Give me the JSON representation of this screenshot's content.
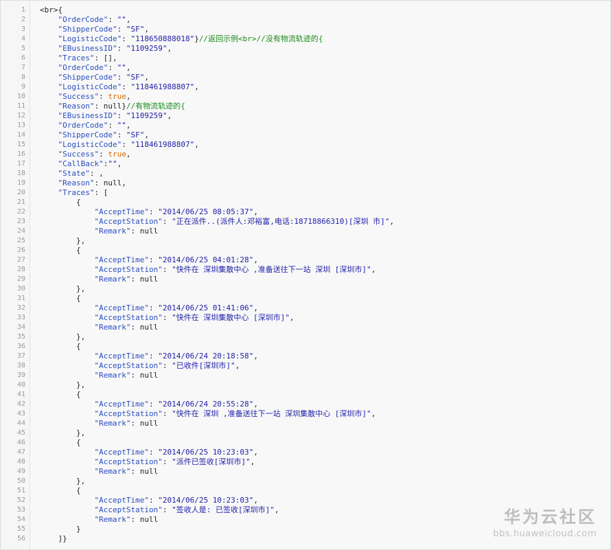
{
  "code_lines": [
    {
      "n": "1",
      "tokens": [
        [
          "punc",
          "<br>{"
        ]
      ]
    },
    {
      "n": "2",
      "tokens": [
        [
          "punc",
          "    "
        ],
        [
          "key",
          "\"OrderCode\""
        ],
        [
          "punc",
          ": "
        ],
        [
          "str",
          "\"\""
        ],
        [
          "punc",
          ","
        ]
      ]
    },
    {
      "n": "3",
      "tokens": [
        [
          "punc",
          "    "
        ],
        [
          "key",
          "\"ShipperCode\""
        ],
        [
          "punc",
          ": "
        ],
        [
          "str",
          "\"SF\""
        ],
        [
          "punc",
          ","
        ]
      ]
    },
    {
      "n": "4",
      "tokens": [
        [
          "punc",
          "    "
        ],
        [
          "key",
          "\"LogisticCode\""
        ],
        [
          "punc",
          ": "
        ],
        [
          "str",
          "\"118650888018\""
        ],
        [
          "punc",
          "}"
        ],
        [
          "comment",
          "//返回示例<br>//没有物流轨迹的{"
        ]
      ]
    },
    {
      "n": "5",
      "tokens": [
        [
          "punc",
          "    "
        ],
        [
          "key",
          "\"EBusinessID\""
        ],
        [
          "punc",
          ": "
        ],
        [
          "str",
          "\"1109259\""
        ],
        [
          "punc",
          ","
        ]
      ]
    },
    {
      "n": "6",
      "tokens": [
        [
          "punc",
          "    "
        ],
        [
          "key",
          "\"Traces\""
        ],
        [
          "punc",
          ": [],"
        ]
      ]
    },
    {
      "n": "7",
      "tokens": [
        [
          "punc",
          "    "
        ],
        [
          "key",
          "\"OrderCode\""
        ],
        [
          "punc",
          ": "
        ],
        [
          "str",
          "\"\""
        ],
        [
          "punc",
          ","
        ]
      ]
    },
    {
      "n": "8",
      "tokens": [
        [
          "punc",
          "    "
        ],
        [
          "key",
          "\"ShipperCode\""
        ],
        [
          "punc",
          ": "
        ],
        [
          "str",
          "\"SF\""
        ],
        [
          "punc",
          ","
        ]
      ]
    },
    {
      "n": "9",
      "tokens": [
        [
          "punc",
          "    "
        ],
        [
          "key",
          "\"LogisticCode\""
        ],
        [
          "punc",
          ": "
        ],
        [
          "str",
          "\"118461988807\""
        ],
        [
          "punc",
          ","
        ]
      ]
    },
    {
      "n": "10",
      "tokens": [
        [
          "punc",
          "    "
        ],
        [
          "key",
          "\"Success\""
        ],
        [
          "punc",
          ": "
        ],
        [
          "bool",
          "true"
        ],
        [
          "punc",
          ","
        ]
      ]
    },
    {
      "n": "11",
      "tokens": [
        [
          "punc",
          "    "
        ],
        [
          "key",
          "\"Reason\""
        ],
        [
          "punc",
          ": null}"
        ],
        [
          "comment",
          "//有物流轨迹的{"
        ]
      ]
    },
    {
      "n": "12",
      "tokens": [
        [
          "punc",
          "    "
        ],
        [
          "key",
          "\"EBusinessID\""
        ],
        [
          "punc",
          ": "
        ],
        [
          "str",
          "\"1109259\""
        ],
        [
          "punc",
          ","
        ]
      ]
    },
    {
      "n": "13",
      "tokens": [
        [
          "punc",
          "    "
        ],
        [
          "key",
          "\"OrderCode\""
        ],
        [
          "punc",
          ": "
        ],
        [
          "str",
          "\"\""
        ],
        [
          "punc",
          ","
        ]
      ]
    },
    {
      "n": "14",
      "tokens": [
        [
          "punc",
          "    "
        ],
        [
          "key",
          "\"ShipperCode\""
        ],
        [
          "punc",
          ": "
        ],
        [
          "str",
          "\"SF\""
        ],
        [
          "punc",
          ","
        ]
      ]
    },
    {
      "n": "15",
      "tokens": [
        [
          "punc",
          "    "
        ],
        [
          "key",
          "\"LogisticCode\""
        ],
        [
          "punc",
          ": "
        ],
        [
          "str",
          "\"118461988807\""
        ],
        [
          "punc",
          ","
        ]
      ]
    },
    {
      "n": "16",
      "tokens": [
        [
          "punc",
          "    "
        ],
        [
          "key",
          "\"Success\""
        ],
        [
          "punc",
          ": "
        ],
        [
          "bool",
          "true"
        ],
        [
          "punc",
          ","
        ]
      ]
    },
    {
      "n": "17",
      "tokens": [
        [
          "punc",
          "    "
        ],
        [
          "key",
          "\"CallBack\""
        ],
        [
          "punc",
          ":"
        ],
        [
          "str",
          "\"\""
        ],
        [
          "punc",
          ","
        ]
      ]
    },
    {
      "n": "18",
      "tokens": [
        [
          "punc",
          "    "
        ],
        [
          "key",
          "\"State\""
        ],
        [
          "punc",
          ": ,"
        ]
      ]
    },
    {
      "n": "19",
      "tokens": [
        [
          "punc",
          "    "
        ],
        [
          "key",
          "\"Reason\""
        ],
        [
          "punc",
          ": null,"
        ]
      ]
    },
    {
      "n": "20",
      "tokens": [
        [
          "punc",
          "    "
        ],
        [
          "key",
          "\"Traces\""
        ],
        [
          "punc",
          ": ["
        ]
      ]
    },
    {
      "n": "21",
      "tokens": [
        [
          "punc",
          "        {"
        ]
      ]
    },
    {
      "n": "22",
      "tokens": [
        [
          "punc",
          "            "
        ],
        [
          "key",
          "\"AcceptTime\""
        ],
        [
          "punc",
          ": "
        ],
        [
          "str",
          "\"2014/06/25 08:05:37\""
        ],
        [
          "punc",
          ","
        ]
      ]
    },
    {
      "n": "23",
      "tokens": [
        [
          "punc",
          "            "
        ],
        [
          "key",
          "\"AcceptStation\""
        ],
        [
          "punc",
          ": "
        ],
        [
          "str",
          "\"正在派件..(派件人:邓裕富,电话:18718866310)[深圳 市]\""
        ],
        [
          "punc",
          ","
        ]
      ]
    },
    {
      "n": "24",
      "tokens": [
        [
          "punc",
          "            "
        ],
        [
          "key",
          "\"Remark\""
        ],
        [
          "punc",
          ": null"
        ]
      ]
    },
    {
      "n": "25",
      "tokens": [
        [
          "punc",
          "        },"
        ]
      ]
    },
    {
      "n": "26",
      "tokens": [
        [
          "punc",
          "        {"
        ]
      ]
    },
    {
      "n": "27",
      "tokens": [
        [
          "punc",
          "            "
        ],
        [
          "key",
          "\"AcceptTime\""
        ],
        [
          "punc",
          ": "
        ],
        [
          "str",
          "\"2014/06/25 04:01:28\""
        ],
        [
          "punc",
          ","
        ]
      ]
    },
    {
      "n": "28",
      "tokens": [
        [
          "punc",
          "            "
        ],
        [
          "key",
          "\"AcceptStation\""
        ],
        [
          "punc",
          ": "
        ],
        [
          "str",
          "\"快件在 深圳集散中心 ,准备送往下一站 深圳 [深圳市]\""
        ],
        [
          "punc",
          ","
        ]
      ]
    },
    {
      "n": "29",
      "tokens": [
        [
          "punc",
          "            "
        ],
        [
          "key",
          "\"Remark\""
        ],
        [
          "punc",
          ": null"
        ]
      ]
    },
    {
      "n": "30",
      "tokens": [
        [
          "punc",
          "        },"
        ]
      ]
    },
    {
      "n": "31",
      "tokens": [
        [
          "punc",
          "        {"
        ]
      ]
    },
    {
      "n": "32",
      "tokens": [
        [
          "punc",
          "            "
        ],
        [
          "key",
          "\"AcceptTime\""
        ],
        [
          "punc",
          ": "
        ],
        [
          "str",
          "\"2014/06/25 01:41:06\""
        ],
        [
          "punc",
          ","
        ]
      ]
    },
    {
      "n": "33",
      "tokens": [
        [
          "punc",
          "            "
        ],
        [
          "key",
          "\"AcceptStation\""
        ],
        [
          "punc",
          ": "
        ],
        [
          "str",
          "\"快件在 深圳集散中心 [深圳市]\""
        ],
        [
          "punc",
          ","
        ]
      ]
    },
    {
      "n": "34",
      "tokens": [
        [
          "punc",
          "            "
        ],
        [
          "key",
          "\"Remark\""
        ],
        [
          "punc",
          ": null"
        ]
      ]
    },
    {
      "n": "35",
      "tokens": [
        [
          "punc",
          "        },"
        ]
      ]
    },
    {
      "n": "36",
      "tokens": [
        [
          "punc",
          "        {"
        ]
      ]
    },
    {
      "n": "37",
      "tokens": [
        [
          "punc",
          "            "
        ],
        [
          "key",
          "\"AcceptTime\""
        ],
        [
          "punc",
          ": "
        ],
        [
          "str",
          "\"2014/06/24 20:18:58\""
        ],
        [
          "punc",
          ","
        ]
      ]
    },
    {
      "n": "38",
      "tokens": [
        [
          "punc",
          "            "
        ],
        [
          "key",
          "\"AcceptStation\""
        ],
        [
          "punc",
          ": "
        ],
        [
          "str",
          "\"已收件[深圳市]\""
        ],
        [
          "punc",
          ","
        ]
      ]
    },
    {
      "n": "39",
      "tokens": [
        [
          "punc",
          "            "
        ],
        [
          "key",
          "\"Remark\""
        ],
        [
          "punc",
          ": null"
        ]
      ]
    },
    {
      "n": "40",
      "tokens": [
        [
          "punc",
          "        },"
        ]
      ]
    },
    {
      "n": "41",
      "tokens": [
        [
          "punc",
          "        {"
        ]
      ]
    },
    {
      "n": "42",
      "tokens": [
        [
          "punc",
          "            "
        ],
        [
          "key",
          "\"AcceptTime\""
        ],
        [
          "punc",
          ": "
        ],
        [
          "str",
          "\"2014/06/24 20:55:28\""
        ],
        [
          "punc",
          ","
        ]
      ]
    },
    {
      "n": "43",
      "tokens": [
        [
          "punc",
          "            "
        ],
        [
          "key",
          "\"AcceptStation\""
        ],
        [
          "punc",
          ": "
        ],
        [
          "str",
          "\"快件在 深圳 ,准备送往下一站 深圳集散中心 [深圳市]\""
        ],
        [
          "punc",
          ","
        ]
      ]
    },
    {
      "n": "44",
      "tokens": [
        [
          "punc",
          "            "
        ],
        [
          "key",
          "\"Remark\""
        ],
        [
          "punc",
          ": null"
        ]
      ]
    },
    {
      "n": "45",
      "tokens": [
        [
          "punc",
          "        },"
        ]
      ]
    },
    {
      "n": "46",
      "tokens": [
        [
          "punc",
          "        {"
        ]
      ]
    },
    {
      "n": "47",
      "tokens": [
        [
          "punc",
          "            "
        ],
        [
          "key",
          "\"AcceptTime\""
        ],
        [
          "punc",
          ": "
        ],
        [
          "str",
          "\"2014/06/25 10:23:03\""
        ],
        [
          "punc",
          ","
        ]
      ]
    },
    {
      "n": "48",
      "tokens": [
        [
          "punc",
          "            "
        ],
        [
          "key",
          "\"AcceptStation\""
        ],
        [
          "punc",
          ": "
        ],
        [
          "str",
          "\"派件已签收[深圳市]\""
        ],
        [
          "punc",
          ","
        ]
      ]
    },
    {
      "n": "49",
      "tokens": [
        [
          "punc",
          "            "
        ],
        [
          "key",
          "\"Remark\""
        ],
        [
          "punc",
          ": null"
        ]
      ]
    },
    {
      "n": "50",
      "tokens": [
        [
          "punc",
          "        },"
        ]
      ]
    },
    {
      "n": "51",
      "tokens": [
        [
          "punc",
          "        {"
        ]
      ]
    },
    {
      "n": "52",
      "tokens": [
        [
          "punc",
          "            "
        ],
        [
          "key",
          "\"AcceptTime\""
        ],
        [
          "punc",
          ": "
        ],
        [
          "str",
          "\"2014/06/25 10:23:03\""
        ],
        [
          "punc",
          ","
        ]
      ]
    },
    {
      "n": "53",
      "tokens": [
        [
          "punc",
          "            "
        ],
        [
          "key",
          "\"AcceptStation\""
        ],
        [
          "punc",
          ": "
        ],
        [
          "str",
          "\"签收人是: 已签收[深圳市]\""
        ],
        [
          "punc",
          ","
        ]
      ]
    },
    {
      "n": "54",
      "tokens": [
        [
          "punc",
          "            "
        ],
        [
          "key",
          "\"Remark\""
        ],
        [
          "punc",
          ": null"
        ]
      ]
    },
    {
      "n": "55",
      "tokens": [
        [
          "punc",
          "        }"
        ]
      ]
    },
    {
      "n": "56",
      "tokens": [
        [
          "punc",
          "    ]}"
        ]
      ]
    }
  ],
  "watermark": {
    "title": "华为云社区",
    "url": "bbs.huaweicloud.com"
  },
  "colors": {
    "key": "#2a4ec0",
    "string": "#2020a8",
    "bool": "#d96a00",
    "comment": "#1a8a1a",
    "line_number": "#9a9a9a"
  }
}
